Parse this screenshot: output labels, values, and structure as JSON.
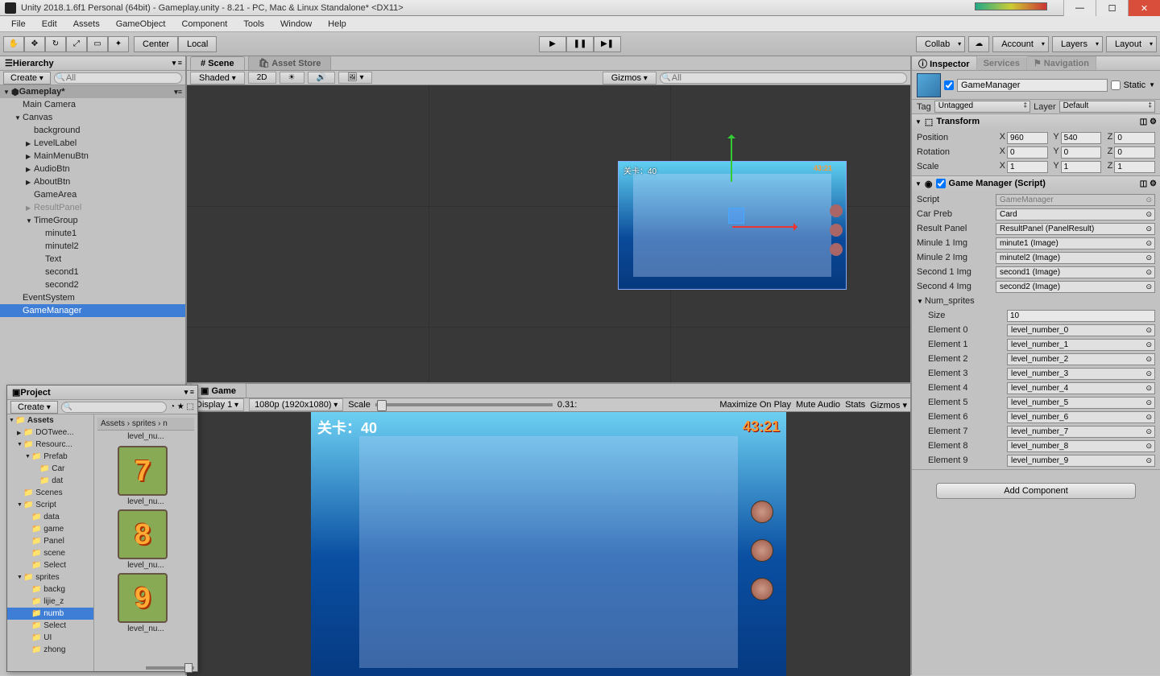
{
  "titlebar": {
    "title": "Unity 2018.1.6f1 Personal (64bit) - Gameplay.unity - 8.21 - PC, Mac & Linux Standalone* <DX11>"
  },
  "menu": [
    "File",
    "Edit",
    "Assets",
    "GameObject",
    "Component",
    "Tools",
    "Window",
    "Help"
  ],
  "toolbar": {
    "pivot": "Center",
    "space": "Local",
    "collab": "Collab",
    "account": "Account",
    "layers": "Layers",
    "layout": "Layout"
  },
  "hierarchy": {
    "tab": "Hierarchy",
    "create": "Create",
    "search_ph": "All",
    "scene": "Gameplay*",
    "items": [
      {
        "name": "Main Camera",
        "indent": 1,
        "arrow": ""
      },
      {
        "name": "Canvas",
        "indent": 1,
        "arrow": "▼"
      },
      {
        "name": "background",
        "indent": 2,
        "arrow": ""
      },
      {
        "name": "LevelLabel",
        "indent": 2,
        "arrow": "▶"
      },
      {
        "name": "MainMenuBtn",
        "indent": 2,
        "arrow": "▶"
      },
      {
        "name": "AudioBtn",
        "indent": 2,
        "arrow": "▶"
      },
      {
        "name": "AboutBtn",
        "indent": 2,
        "arrow": "▶"
      },
      {
        "name": "GameArea",
        "indent": 2,
        "arrow": ""
      },
      {
        "name": "ResultPanel",
        "indent": 2,
        "arrow": "▶",
        "gray": true
      },
      {
        "name": "TimeGroup",
        "indent": 2,
        "arrow": "▼"
      },
      {
        "name": "minute1",
        "indent": 3,
        "arrow": ""
      },
      {
        "name": "minutel2",
        "indent": 3,
        "arrow": ""
      },
      {
        "name": "Text",
        "indent": 3,
        "arrow": ""
      },
      {
        "name": "second1",
        "indent": 3,
        "arrow": ""
      },
      {
        "name": "second2",
        "indent": 3,
        "arrow": ""
      },
      {
        "name": "EventSystem",
        "indent": 1,
        "arrow": ""
      },
      {
        "name": "GameManager",
        "indent": 1,
        "arrow": "",
        "selected": true
      }
    ]
  },
  "scene": {
    "tab": "Scene",
    "asset_tab": "Asset Store",
    "shaded": "Shaded",
    "mode2d": "2D",
    "gizmos": "Gizmos",
    "search_ph": "All",
    "level_text": "关卡：40",
    "timer": "43:21"
  },
  "game": {
    "tab": "Game",
    "display": "Display 1",
    "resolution": "1080p (1920x1080)",
    "scale_label": "Scale",
    "scale_value": "0.31:",
    "maximize": "Maximize On Play",
    "mute": "Mute Audio",
    "stats": "Stats",
    "gizmos": "Gizmos",
    "level_text": "关卡：40",
    "timer": "43:21"
  },
  "project": {
    "tab": "Project",
    "create": "Create",
    "breadcrumb": "Assets  ›  sprites  ›  n",
    "folders": [
      {
        "name": "Assets",
        "indent": 0,
        "arrow": "▼",
        "bold": true
      },
      {
        "name": "DOTwee...",
        "indent": 1,
        "arrow": "▶"
      },
      {
        "name": "Resourc...",
        "indent": 1,
        "arrow": "▼"
      },
      {
        "name": "Prefab",
        "indent": 2,
        "arrow": "▼"
      },
      {
        "name": "Car",
        "indent": 3,
        "arrow": ""
      },
      {
        "name": "dat",
        "indent": 3,
        "arrow": ""
      },
      {
        "name": "Scenes",
        "indent": 1,
        "arrow": ""
      },
      {
        "name": "Script",
        "indent": 1,
        "arrow": "▼"
      },
      {
        "name": "data",
        "indent": 2,
        "arrow": ""
      },
      {
        "name": "game",
        "indent": 2,
        "arrow": ""
      },
      {
        "name": "Panel",
        "indent": 2,
        "arrow": ""
      },
      {
        "name": "scene",
        "indent": 2,
        "arrow": ""
      },
      {
        "name": "Select",
        "indent": 2,
        "arrow": ""
      },
      {
        "name": "sprites",
        "indent": 1,
        "arrow": "▼"
      },
      {
        "name": "backg",
        "indent": 2,
        "arrow": ""
      },
      {
        "name": "lijie_z",
        "indent": 2,
        "arrow": ""
      },
      {
        "name": "numb",
        "indent": 2,
        "arrow": "",
        "selected": true
      },
      {
        "name": "Select",
        "indent": 2,
        "arrow": ""
      },
      {
        "name": "UI",
        "indent": 2,
        "arrow": ""
      },
      {
        "name": "zhong",
        "indent": 2,
        "arrow": ""
      }
    ],
    "thumb_top": "level_nu...",
    "thumbs": [
      {
        "digit": "7",
        "label": "level_nu..."
      },
      {
        "digit": "8",
        "label": "level_nu..."
      },
      {
        "digit": "9",
        "label": "level_nu..."
      }
    ]
  },
  "inspector": {
    "tabs": [
      "Inspector",
      "Services",
      "Navigation"
    ],
    "name": "GameManager",
    "static": "Static",
    "tag_label": "Tag",
    "tag": "Untagged",
    "layer_label": "Layer",
    "layer": "Default",
    "transform": {
      "title": "Transform",
      "position": {
        "label": "Position",
        "x": "960",
        "y": "540",
        "z": "0"
      },
      "rotation": {
        "label": "Rotation",
        "x": "0",
        "y": "0",
        "z": "0"
      },
      "scale": {
        "label": "Scale",
        "x": "1",
        "y": "1",
        "z": "1"
      }
    },
    "gamemanager": {
      "title": "Game Manager (Script)",
      "props": [
        {
          "label": "Script",
          "value": "GameManager",
          "disabled": true
        },
        {
          "label": "Car Preb",
          "value": "Card"
        },
        {
          "label": "Result Panel",
          "value": "ResultPanel (PanelResult)"
        },
        {
          "label": "Minule 1 Img",
          "value": "minute1 (Image)"
        },
        {
          "label": "Minule 2 Img",
          "value": "minutel2 (Image)"
        },
        {
          "label": "Second 1 Img",
          "value": "second1 (Image)"
        },
        {
          "label": "Second 4 Img",
          "value": "second2 (Image)"
        }
      ],
      "array_label": "Num_sprites",
      "size_label": "Size",
      "size": "10",
      "elements": [
        {
          "label": "Element 0",
          "value": "level_number_0"
        },
        {
          "label": "Element 1",
          "value": "level_number_1"
        },
        {
          "label": "Element 2",
          "value": "level_number_2"
        },
        {
          "label": "Element 3",
          "value": "level_number_3"
        },
        {
          "label": "Element 4",
          "value": "level_number_4"
        },
        {
          "label": "Element 5",
          "value": "level_number_5"
        },
        {
          "label": "Element 6",
          "value": "level_number_6"
        },
        {
          "label": "Element 7",
          "value": "level_number_7"
        },
        {
          "label": "Element 8",
          "value": "level_number_8"
        },
        {
          "label": "Element 9",
          "value": "level_number_9"
        }
      ]
    },
    "add_component": "Add Component"
  }
}
